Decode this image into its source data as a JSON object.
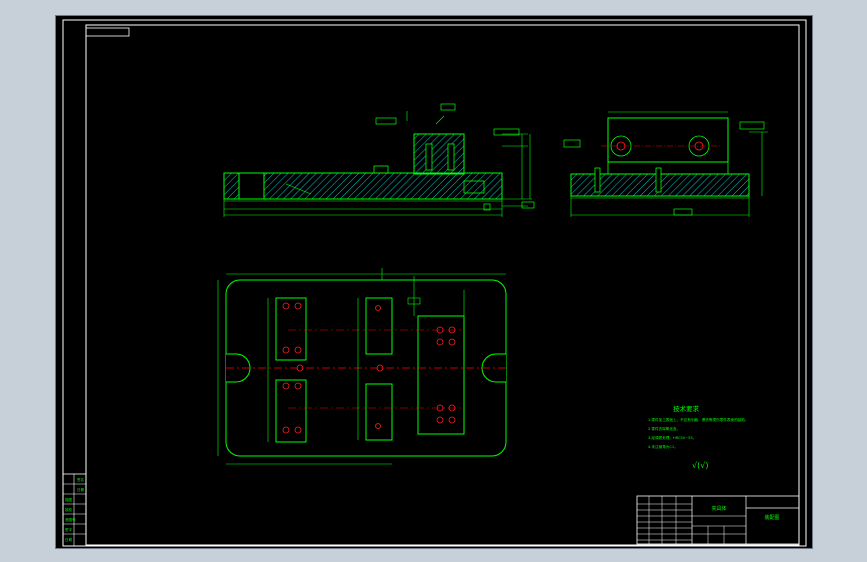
{
  "drawing": {
    "tech_requirements": {
      "title": "技术要求",
      "lines": [
        "1.零件加工表面上，不应有划痕、擦伤等损伤零件表面的缺陷。",
        "2.零件去除氧化皮。",
        "3.经调质处理，HRC50~55。",
        "4.未注倒角为C1。"
      ]
    },
    "roughness_note": "√(√)",
    "title_block": {
      "part_name": "夹具体",
      "right_label": "装配图"
    },
    "left_stamp": {
      "rows": [
        "签名",
        "日期",
        "描图",
        "描校",
        "底图号",
        "签字",
        "日期"
      ]
    }
  },
  "colors": {
    "background": "#000000",
    "border": "#ffffff",
    "outline": "#00ff00",
    "hatch": "#00c8c8",
    "dimension": "#00ff00",
    "centerline": "#ff0000",
    "holes": "#ff2020"
  }
}
